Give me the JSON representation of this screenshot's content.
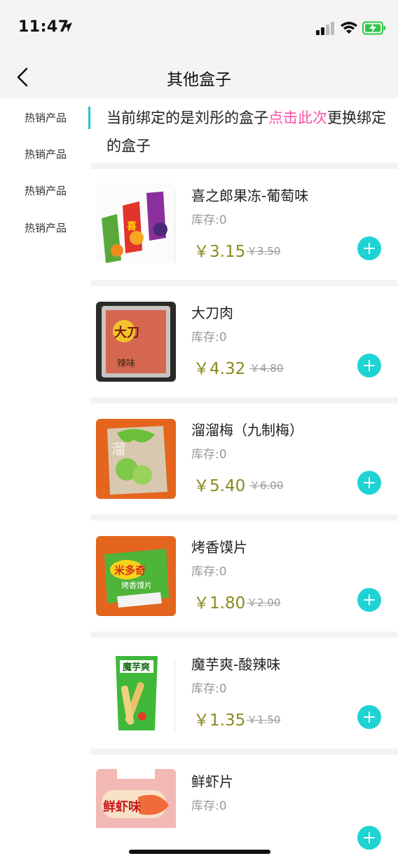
{
  "status_bar": {
    "time": "11:47"
  },
  "nav": {
    "title": "其他盒子"
  },
  "sidebar": {
    "items": [
      {
        "label": "热销产品"
      },
      {
        "label": "热销产品"
      },
      {
        "label": "热销产品"
      },
      {
        "label": "热销产品"
      }
    ]
  },
  "notice": {
    "prefix": "当前绑定的是刘彤的盒子",
    "link": "点击此次",
    "suffix": "更换绑定的盒子"
  },
  "products": [
    {
      "name": "喜之郎果冻-葡萄味",
      "stock": "库存:0",
      "price": "￥3.15",
      "old_price": "￥3.50",
      "thumb_icon": "jelly-pouch-icon"
    },
    {
      "name": "大刀肉",
      "stock": "库存:0",
      "price": "￥4.32",
      "old_price": "￥4.80",
      "thumb_icon": "snack-bag-icon"
    },
    {
      "name": "溜溜梅（九制梅）",
      "stock": "库存:0",
      "price": "￥5.40",
      "old_price": "￥6.00",
      "thumb_icon": "plum-bag-icon"
    },
    {
      "name": "烤香馍片",
      "stock": "库存:0",
      "price": "￥1.80",
      "old_price": "￥2.00",
      "thumb_icon": "cracker-bag-icon"
    },
    {
      "name": "魔芋爽-酸辣味",
      "stock": "库存:0",
      "price": "￥1.35",
      "old_price": "￥1.50",
      "thumb_icon": "konjac-bag-icon"
    },
    {
      "name": "鲜虾片",
      "stock": "库存:0",
      "price": "",
      "old_price": "",
      "thumb_icon": "shrimp-chips-bag-icon"
    }
  ],
  "colors": {
    "accent": "#1fd3d3",
    "link": "#ff4fa7",
    "price": "#8a8a1f",
    "indicator": "#22c6d4"
  }
}
